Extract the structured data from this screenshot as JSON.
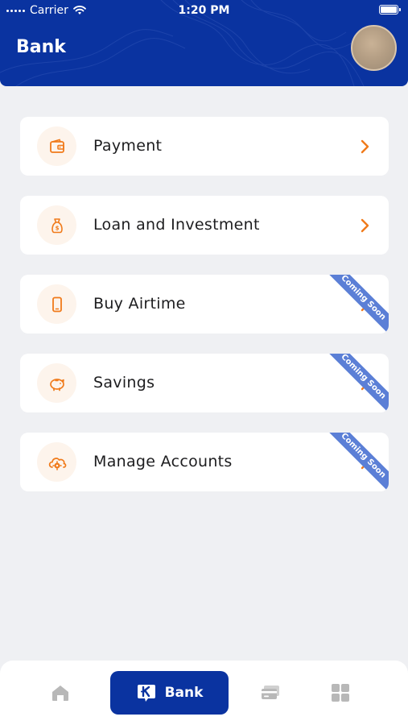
{
  "status_bar": {
    "carrier": "Carrier",
    "time": "1:20 PM"
  },
  "header": {
    "title": "Bank",
    "avatar_icon": "profile-photo"
  },
  "menu": {
    "items": [
      {
        "label": "Payment",
        "icon": "wallet-icon",
        "coming_soon": false
      },
      {
        "label": "Loan and Investment",
        "icon": "money-bag-icon",
        "coming_soon": false
      },
      {
        "label": "Buy Airtime",
        "icon": "phone-icon",
        "coming_soon": true,
        "badge": "Coming Soon"
      },
      {
        "label": "Savings",
        "icon": "piggy-bank-icon",
        "coming_soon": true,
        "badge": "Coming Soon"
      },
      {
        "label": "Manage Accounts",
        "icon": "cloud-gear-icon",
        "coming_soon": true,
        "badge": "Coming Soon"
      }
    ]
  },
  "bottom_nav": {
    "items": [
      {
        "icon": "home-icon",
        "active": false
      },
      {
        "icon": "bank-icon",
        "label": "Bank",
        "active": true
      },
      {
        "icon": "card-icon",
        "active": false
      },
      {
        "icon": "grid-icon",
        "active": false
      }
    ]
  },
  "colors": {
    "primary": "#0a33a0",
    "accent": "#f07a1a",
    "ribbon": "#5b7fd6",
    "background": "#eff0f3",
    "inactive_icon": "#b8b8b8"
  }
}
